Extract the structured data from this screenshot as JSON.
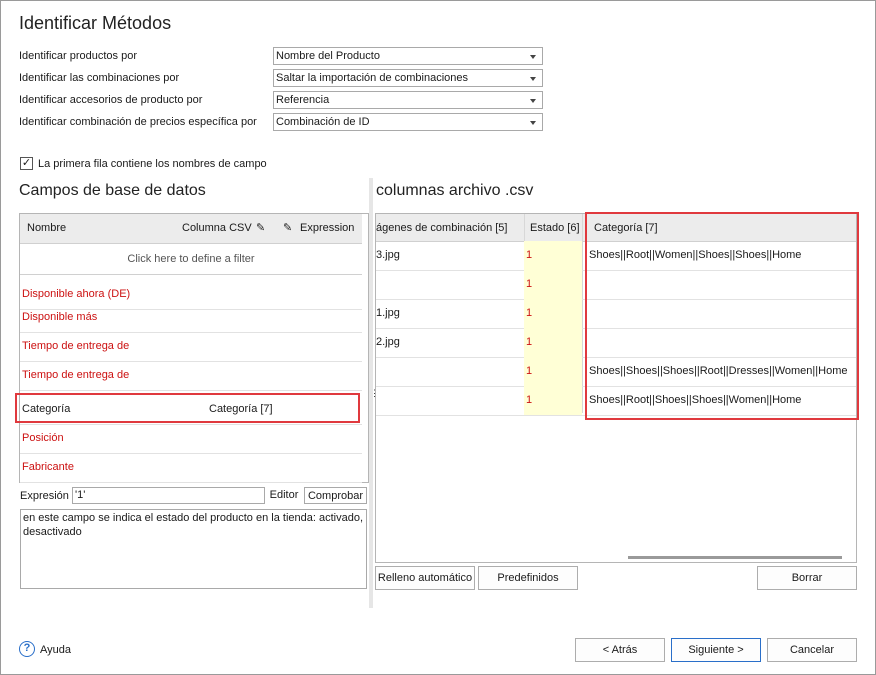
{
  "title": "Identificar Métodos",
  "identify": {
    "rows": [
      {
        "label": "Identificar productos por",
        "value": "Nombre del Producto"
      },
      {
        "label": "Identificar las combinaciones por",
        "value": "Saltar la importación de combinaciones"
      },
      {
        "label": "Identificar accesorios de producto por",
        "value": "Referencia"
      },
      {
        "label": "Identificar combinación de precios específica por",
        "value": "Combinación de ID"
      }
    ]
  },
  "first_row_checkbox": {
    "checked": true,
    "check_glyph": "✓",
    "label": "La primera fila contiene los nombres de campo"
  },
  "left": {
    "title": "Campos de base de datos",
    "headers": {
      "name": "Nombre",
      "csv": "Columna CSV",
      "expression": "Expression"
    },
    "filter_text": "Click here to define a filter",
    "rows": [
      {
        "name": "Disponible ahora (DE)",
        "csv": ""
      },
      {
        "name": "Disponible más",
        "csv": ""
      },
      {
        "name": "Tiempo de entrega de",
        "csv": ""
      },
      {
        "name": "Tiempo de entrega de",
        "csv": ""
      },
      {
        "name": "Categoría",
        "csv": "Categoría [7]"
      },
      {
        "name": "Posición",
        "csv": ""
      },
      {
        "name": "Fabricante",
        "csv": ""
      }
    ],
    "expression_label": "Expresión",
    "expression_value": "'1'",
    "editor_label": "Editor",
    "check_label": "Comprobar",
    "description": "en este campo se indica el estado del producto en la tienda: activado, desactivado"
  },
  "right": {
    "title": "columnas archivo .csv",
    "headers": {
      "images": "ágenes de combinación [5]",
      "estado": "Estado [6]",
      "categoria": "Categoría [7]"
    },
    "rows": [
      {
        "images": "3.jpg",
        "estado": "1",
        "categoria": "Shoes||Root||Women||Shoes||Shoes||Home"
      },
      {
        "images": "",
        "estado": "1",
        "categoria": ""
      },
      {
        "images": "1.jpg",
        "estado": "1",
        "categoria": ""
      },
      {
        "images": "2.jpg",
        "estado": "1",
        "categoria": ""
      },
      {
        "images": "",
        "estado": "1",
        "categoria": "Shoes||Shoes||Shoes||Root||Dresses||Women||Home"
      },
      {
        "images": "",
        "estado": "1",
        "categoria": "Shoes||Root||Shoes||Shoes||Women||Home"
      }
    ],
    "buttons": {
      "autofill": "Relleno automático",
      "presets": "Predefinidos",
      "clear": "Borrar"
    }
  },
  "footer": {
    "help_glyph": "?",
    "help_label": "Ayuda",
    "back": "< Atrás",
    "next": "Siguiente >",
    "cancel": "Cancelar"
  },
  "colors": {
    "highlight": "#e0393e",
    "required_field": "#cc1111",
    "estado_cell": "#ffffd6",
    "help_icon": "#2a6fc9"
  }
}
